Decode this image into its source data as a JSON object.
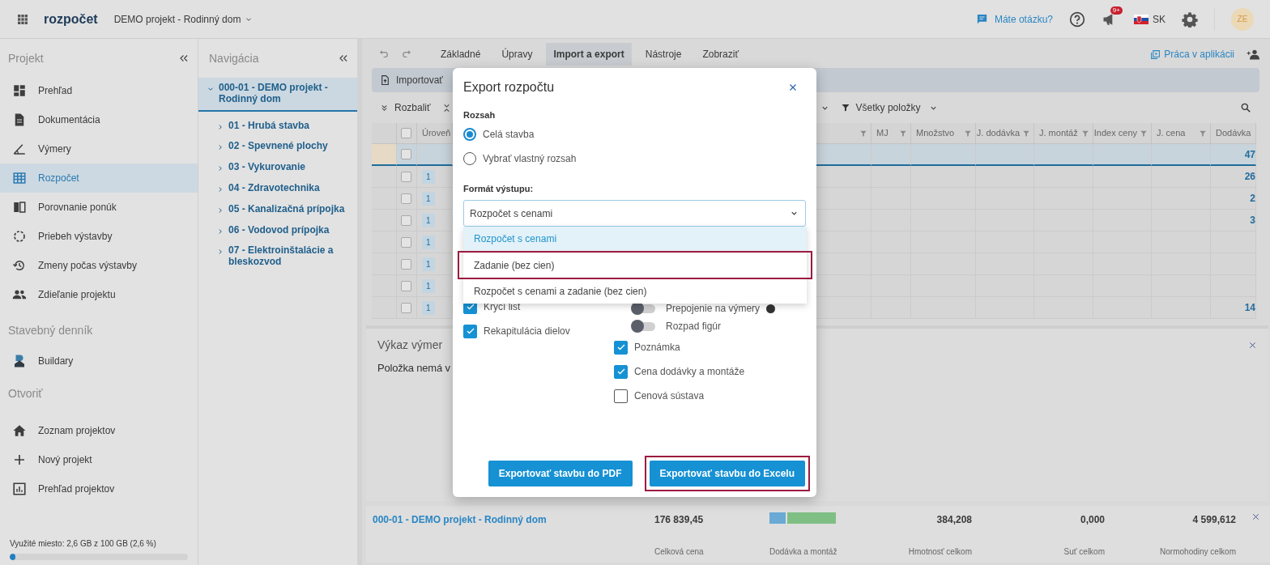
{
  "topbar": {
    "logo": "rozpočet",
    "project": "DEMO projekt - Rodinný dom",
    "help_link": "Máte otázku?",
    "notification_count": "9+",
    "language": "SK",
    "avatar": "ZE"
  },
  "sidebar": {
    "groups": [
      {
        "heading": "Projekt",
        "items": [
          {
            "label": "Prehľad",
            "selected": false
          },
          {
            "label": "Dokumentácia",
            "selected": false
          },
          {
            "label": "Výmery",
            "selected": false
          },
          {
            "label": "Rozpočet",
            "selected": true
          },
          {
            "label": "Porovnanie ponúk",
            "selected": false
          },
          {
            "label": "Priebeh výstavby",
            "selected": false
          },
          {
            "label": "Zmeny počas výstavby",
            "selected": false
          },
          {
            "label": "Zdieľanie projektu",
            "selected": false
          }
        ]
      },
      {
        "heading": "Stavebný denník",
        "items": [
          {
            "label": "Buildary",
            "selected": false
          }
        ]
      },
      {
        "heading": "Otvoriť",
        "items": [
          {
            "label": "Zoznam projektov",
            "selected": false
          },
          {
            "label": "Nový projekt",
            "selected": false
          },
          {
            "label": "Prehľad projektov",
            "selected": false
          }
        ]
      }
    ],
    "storage": {
      "text": "Využité miesto: 2,6 GB z 100 GB (2,6 %)",
      "level": 0.026
    }
  },
  "navigation": {
    "title": "Navigácia",
    "tree": [
      {
        "label": "000-01 - DEMO projekt - Rodinný dom",
        "expanded": true,
        "selected": true,
        "children": [
          {
            "label": "01 - Hrubá stavba",
            "expanded": false,
            "selected": false
          },
          {
            "label": "02 - Spevnené plochy",
            "expanded": false,
            "selected": false
          },
          {
            "label": "03 - Vykurovanie",
            "expanded": false,
            "selected": false
          },
          {
            "label": "04 - Zdravotechnika",
            "expanded": false,
            "selected": false
          },
          {
            "label": "05 - Kanalizačná prípojka",
            "expanded": false,
            "selected": false
          },
          {
            "label": "06 - Vodovod prípojka",
            "expanded": false,
            "selected": false
          },
          {
            "label": "07 - Elektroinštalácie a bleskozvod",
            "expanded": false,
            "selected": false
          }
        ]
      }
    ]
  },
  "ribbon": {
    "tabs": [
      {
        "label": "Základné",
        "selected": false
      },
      {
        "label": "Úpravy",
        "selected": false
      },
      {
        "label": "Import a export",
        "selected": true
      },
      {
        "label": "Nástroje",
        "selected": false
      },
      {
        "label": "Zobraziť",
        "selected": false
      }
    ],
    "guide_link": "Práca v aplikácii",
    "import_button": "Importovať"
  },
  "toolbar": {
    "expand_button": "Rozbaliť",
    "filter": "Všetky položky"
  },
  "table": {
    "header_checked": false,
    "columns": [
      "Úroveň",
      "MJ",
      "Množstvo",
      "J. dodávka",
      "J. montáž",
      "Index ceny",
      "J. cena",
      "Dodávka"
    ],
    "rows": [
      {
        "selected": true,
        "checked": false,
        "supply": "47"
      },
      {
        "selected": false,
        "checked": false,
        "badge": "1",
        "supply": "26"
      },
      {
        "selected": false,
        "checked": false,
        "badge": "1",
        "supply": "2"
      },
      {
        "selected": false,
        "checked": false,
        "badge": "1",
        "supply": "3"
      },
      {
        "selected": false,
        "checked": false,
        "badge": "1"
      },
      {
        "selected": false,
        "checked": false,
        "badge": "1"
      },
      {
        "selected": false,
        "checked": false,
        "badge": "1"
      },
      {
        "selected": false,
        "checked": false,
        "badge": "1",
        "supply": "14"
      }
    ]
  },
  "quantities_panel": {
    "title": "Výkaz výmer",
    "message": "Položka nemá v"
  },
  "summary": {
    "name": "000-01 - DEMO projekt - Rodinný dom",
    "stats": [
      {
        "kind": "value",
        "value": "176 839,45",
        "label": "Celková cena"
      },
      {
        "kind": "bar",
        "level": 0.27,
        "label": "Dodávka a montáž"
      },
      {
        "kind": "value",
        "value": "384,208",
        "label": "Hmotnosť celkom"
      },
      {
        "kind": "value",
        "value": "0,000",
        "label": "Suť celkom"
      },
      {
        "kind": "value",
        "value": "4 599,612",
        "label": "Normohodiny celkom"
      }
    ]
  },
  "export_dialog": {
    "title": "Export rozpočtu",
    "scope_label": "Rozsah",
    "scope_options": [
      {
        "label": "Celá stavba",
        "selected": true
      },
      {
        "label": "Vybrať vlastný rozsah",
        "selected": false
      }
    ],
    "format_label": "Formát výstupu:",
    "format_value": "Rozpočet s cenami",
    "expanded": true,
    "format_options": [
      {
        "label": "Rozpočet s cenami",
        "selected": true,
        "highlighted": false
      },
      {
        "label": "Zadanie (bez cien)",
        "selected": false,
        "highlighted": true
      },
      {
        "label": "Rozpočet s cenami a zadanie (bez cien)",
        "selected": false,
        "highlighted": false
      }
    ],
    "options_left": [
      {
        "kind": "checkbox",
        "label": "Krycí list",
        "checked": true
      },
      {
        "kind": "checkbox",
        "label": "Rekapitulácia dielov",
        "checked": true
      }
    ],
    "options_right": [
      {
        "kind": "toggle",
        "label": "Prepojenie na výmery",
        "checked": false,
        "info": true
      },
      {
        "kind": "toggle",
        "label": "Rozpad figúr",
        "checked": false
      },
      {
        "kind": "checkbox",
        "label": "Poznámka",
        "checked": true
      },
      {
        "kind": "checkbox",
        "label": "Cena dodávky a montáže",
        "checked": true
      },
      {
        "kind": "checkbox",
        "label": "Cenová sústava",
        "checked": false
      }
    ],
    "buttons": [
      {
        "label": "Exportovať stavbu do PDF",
        "highlighted": false
      },
      {
        "label": "Exportovať stavbu do Excelu",
        "highlighted": true
      }
    ]
  }
}
